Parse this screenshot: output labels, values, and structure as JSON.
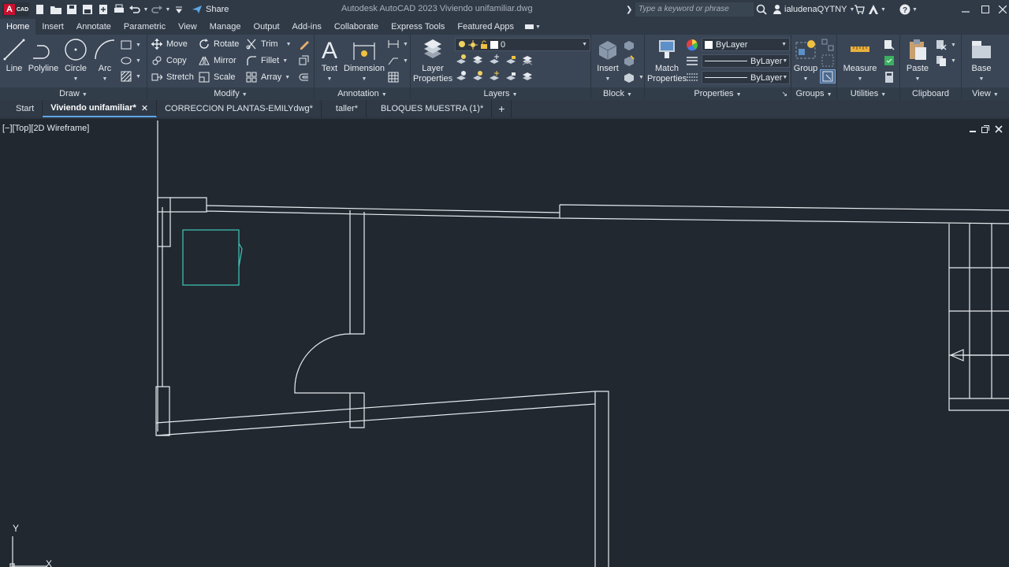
{
  "app": {
    "logo_letter": "A",
    "logo_sub": "CAD",
    "title": "Autodesk AutoCAD 2023   Viviendo unifamiliar.dwg",
    "share_label": "Share",
    "search_placeholder": "Type a keyword or phrase",
    "user": "ialudenaQYTNY"
  },
  "ribbon_tabs": [
    "Home",
    "Insert",
    "Annotate",
    "Parametric",
    "View",
    "Manage",
    "Output",
    "Add-ins",
    "Collaborate",
    "Express Tools",
    "Featured Apps"
  ],
  "ribbon": {
    "draw": {
      "title": "Draw",
      "line": "Line",
      "polyline": "Polyline",
      "circle": "Circle",
      "arc": "Arc"
    },
    "modify": {
      "title": "Modify",
      "move": "Move",
      "rotate": "Rotate",
      "trim": "Trim",
      "copy": "Copy",
      "mirror": "Mirror",
      "fillet": "Fillet",
      "stretch": "Stretch",
      "scale": "Scale",
      "array": "Array"
    },
    "annotation": {
      "title": "Annotation",
      "text": "Text",
      "dimension": "Dimension"
    },
    "layers": {
      "title": "Layers",
      "layer_properties_1": "Layer",
      "layer_properties_2": "Properties",
      "current_layer": "0"
    },
    "block": {
      "title": "Block",
      "insert": "Insert"
    },
    "properties": {
      "title": "Properties",
      "match_1": "Match",
      "match_2": "Properties",
      "color": "ByLayer",
      "linetype": "ByLayer",
      "lineweight": "ByLayer"
    },
    "groups": {
      "title": "Groups",
      "group": "Group"
    },
    "utilities": {
      "title": "Utilities",
      "measure": "Measure"
    },
    "clipboard": {
      "title": "Clipboard",
      "paste": "Paste"
    },
    "view": {
      "title": "View",
      "base": "Base"
    }
  },
  "file_tabs": [
    {
      "label": "Start"
    },
    {
      "label": "Viviendo unifamiliar*"
    },
    {
      "label": "CORRECCION PLANTAS-EMILYdwg*"
    },
    {
      "label": "taller*"
    },
    {
      "label": "BLOQUES MUESTRA (1)*"
    }
  ],
  "viewport": {
    "label": "[−][Top][2D Wireframe]",
    "axis_y": "Y",
    "axis_x": "X"
  },
  "colors": {
    "accent": "#5da7e8",
    "selection": "#40c8b8",
    "line": "#e8ecf0"
  }
}
